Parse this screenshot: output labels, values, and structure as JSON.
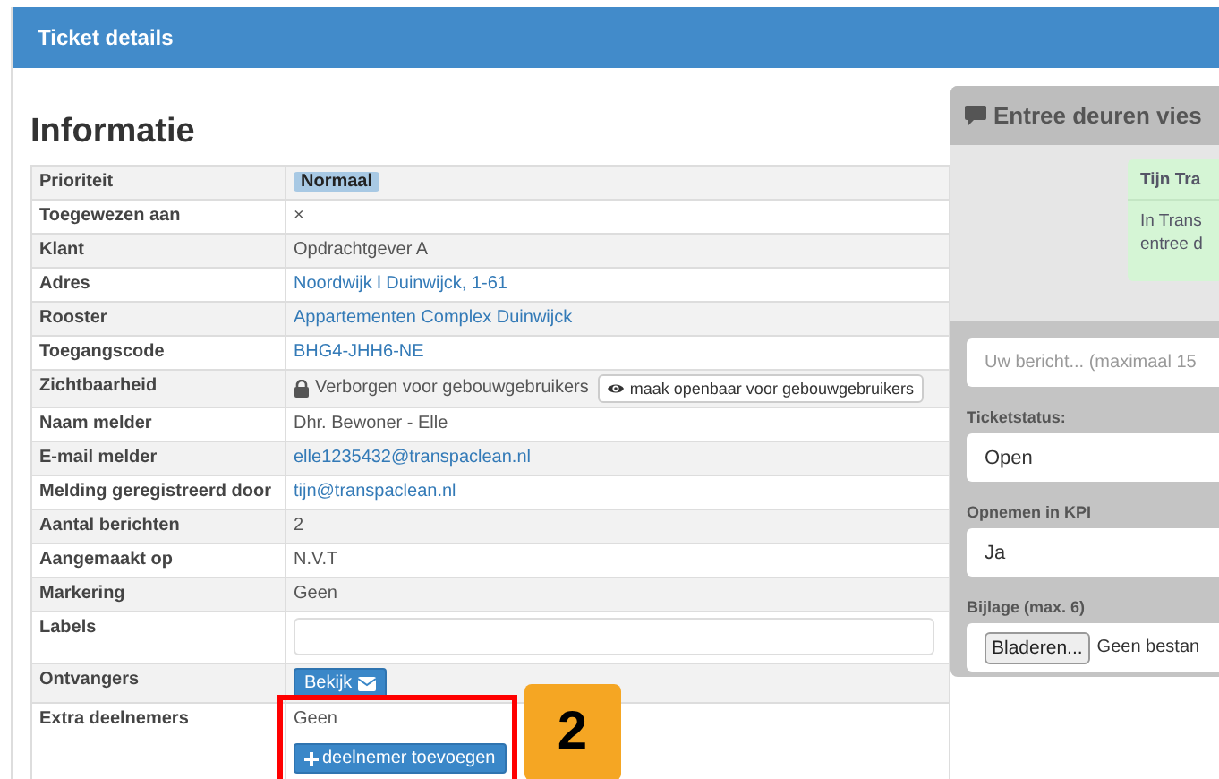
{
  "window": {
    "title": "Ticket details"
  },
  "section_title": "Informatie",
  "rows": [
    {
      "label": "Prioriteit",
      "kind": "badge",
      "value": "Normaal"
    },
    {
      "label": "Toegewezen aan",
      "kind": "remove",
      "value": "×"
    },
    {
      "label": "Klant",
      "kind": "text",
      "value": "Opdrachtgever A"
    },
    {
      "label": "Adres",
      "kind": "link",
      "value": "Noordwijk l Duinwijck, 1-61"
    },
    {
      "label": "Rooster",
      "kind": "link",
      "value": "Appartementen Complex Duinwijck"
    },
    {
      "label": "Toegangscode",
      "kind": "link",
      "value": "BHG4-JHH6-NE"
    },
    {
      "label": "Zichtbaarheid",
      "kind": "visibility",
      "value": "Verborgen voor gebouwgebruikers",
      "button": "maak openbaar voor gebouwgebruikers"
    },
    {
      "label": "Naam melder",
      "kind": "text",
      "value": "Dhr. Bewoner - Elle"
    },
    {
      "label": "E-mail melder",
      "kind": "link",
      "value": "elle1235432@transpaclean.nl"
    },
    {
      "label": "Melding geregistreerd door",
      "kind": "link",
      "value": "tijn@transpaclean.nl"
    },
    {
      "label": "Aantal berichten",
      "kind": "text",
      "value": "2"
    },
    {
      "label": "Aangemaakt op",
      "kind": "text",
      "value": "N.V.T"
    },
    {
      "label": "Markering",
      "kind": "text",
      "value": "Geen"
    },
    {
      "label": "Labels",
      "kind": "field"
    },
    {
      "label": "Ontvangers",
      "kind": "mail_button",
      "button": "Bekijk"
    },
    {
      "label": "Extra deelnemers",
      "kind": "participants",
      "value": "Geen",
      "button": "deelnemer toevoegen"
    }
  ],
  "chat": {
    "title": "Entree deuren vies",
    "message": {
      "author": "Tijn Tra",
      "lines": [
        "In Trans",
        "entree d"
      ]
    },
    "input": {
      "placeholder": "Uw bericht... (maximaal 15"
    },
    "fields": [
      {
        "label": "Ticketstatus:",
        "value": "Open"
      },
      {
        "label": "Opnemen in KPI",
        "value": "Ja"
      }
    ],
    "attachment": {
      "label": "Bijlage (max. 6)",
      "button": "Bladeren...",
      "status": "Geen bestan"
    }
  },
  "annotation": {
    "label": "2"
  }
}
